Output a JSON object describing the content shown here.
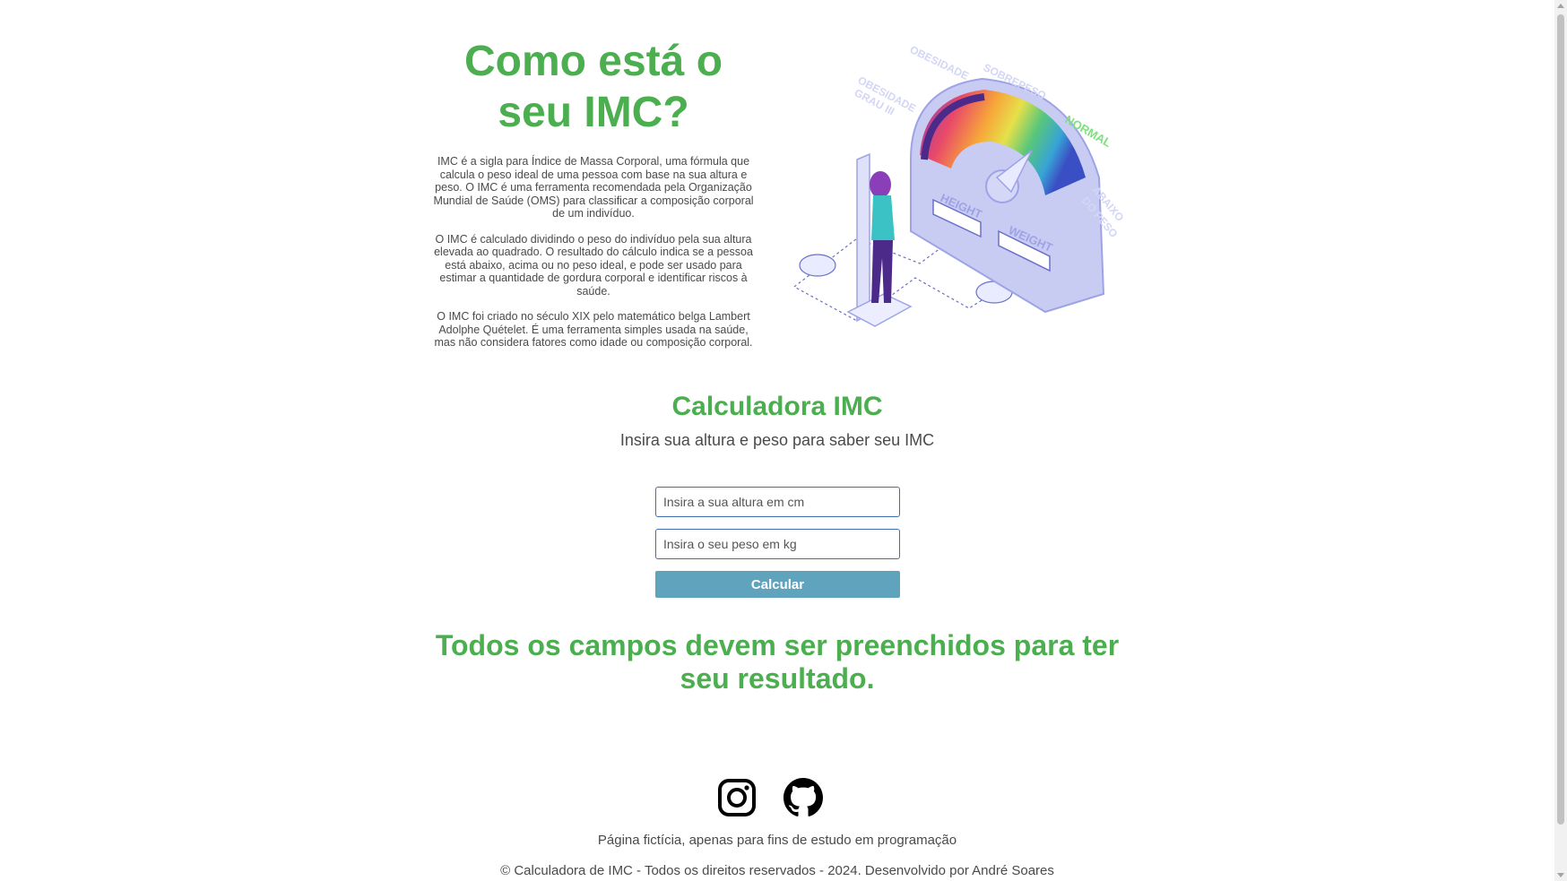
{
  "intro": {
    "title_line1": "Como está o",
    "title_line2": "seu IMC?",
    "paragraphs": [
      "IMC é a sigla para Índice de Massa Corporal, uma fórmula que calcula o peso ideal de uma pessoa com base na sua altura e peso. O IMC é uma ferramenta recomendada pela Organização Mundial de Saúde (OMS) para classificar a composição corporal de um indivíduo.",
      "O IMC é calculado dividindo o peso do indivíduo pela sua altura elevada ao quadrado. O resultado do cálculo indica se a pessoa está abaixo, acima ou no peso ideal, e pode ser usado para estimar a quantidade de gordura corporal e identificar riscos à saúde.",
      "O IMC foi criado no século XIX pelo matemático belga Lambert Adolphe Quételet. É uma ferramenta simples usada na saúde, mas não considera fatores como idade ou composição corporal."
    ]
  },
  "illustration": {
    "labels": {
      "obesity": "OBESIDADE",
      "overweight": "SOBREPESO",
      "obesity_grade3_line1": "OBESIDADE",
      "obesity_grade3_line2": "GRAU III",
      "normal": "NORMAL",
      "under_line1": "ABAIXO",
      "under_line2": "DO PESO",
      "height": "HEIGHT",
      "weight": "WEIGHT"
    },
    "colors": {
      "normal_label": "#7ee07e",
      "gauge_body": "#c8ccf3",
      "outline": "#6b70c9"
    }
  },
  "calculator": {
    "title": "Calculadora IMC",
    "subtitle": "Insira sua altura e peso para saber seu IMC",
    "height_placeholder": "Insira a sua altura em cm",
    "weight_placeholder": "Insira o seu peso em kg",
    "height_value": "",
    "weight_value": "",
    "button_label": "Calcular",
    "result_message": "Todos os campos devem ser preenchidos para ter seu resultado."
  },
  "footer": {
    "socials": [
      {
        "icon": "instagram-icon"
      },
      {
        "icon": "github-icon"
      }
    ],
    "note": "Página fictícia, apenas para fins de estudo em programação",
    "copyright": "© Calculadora de IMC - Todos os direitos reservados - 2024. Desenvolvido por André Soares"
  },
  "theme": {
    "accent": "#4bae4f",
    "button": "#5fa3bd",
    "input_border": "#3f6fb0"
  }
}
